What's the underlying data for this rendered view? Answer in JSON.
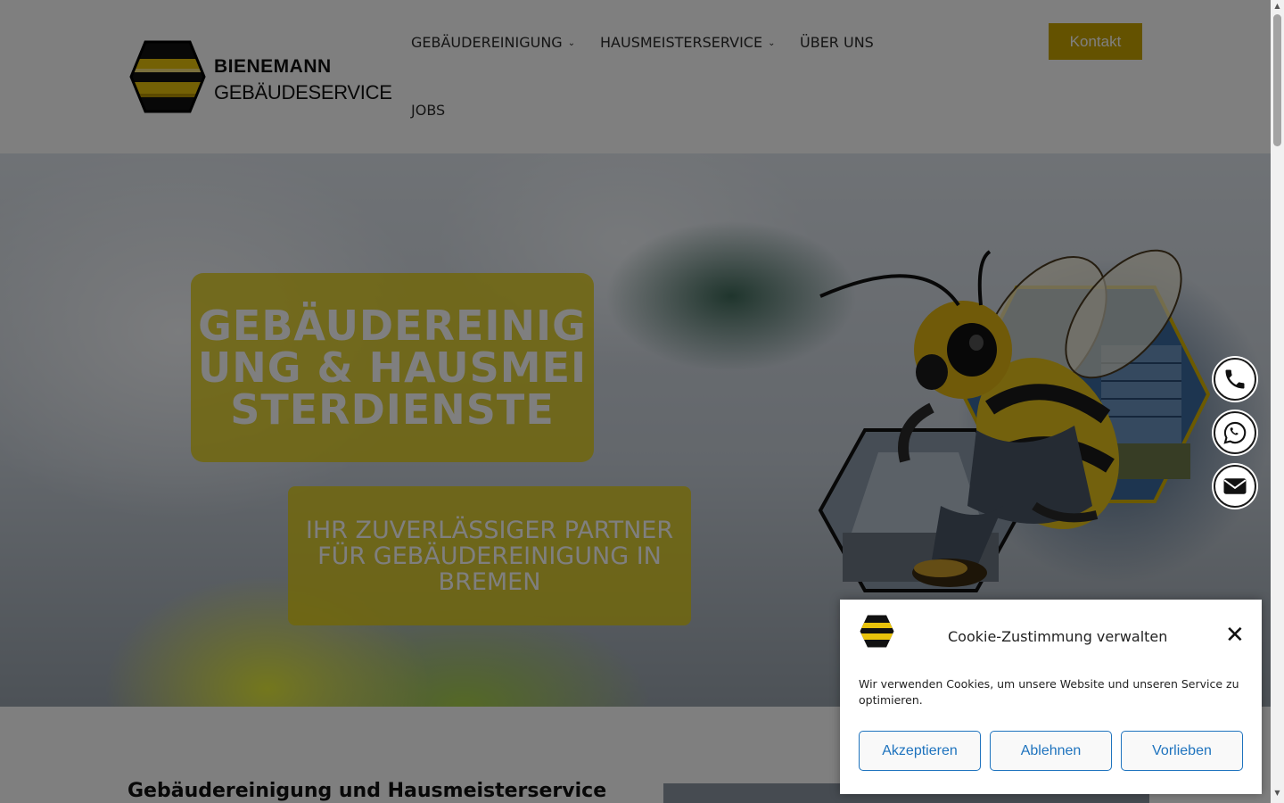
{
  "header": {
    "logo": {
      "line1": "BIENEMANN",
      "line2": "GEBÄUDESERVICE"
    },
    "nav": [
      {
        "label": "GEBÄUDEREINIGUNG",
        "has_dropdown": true
      },
      {
        "label": "HAUSMEISTERSERVICE",
        "has_dropdown": true
      },
      {
        "label": "ÜBER UNS",
        "has_dropdown": false
      },
      {
        "label": "JOBS",
        "has_dropdown": false
      }
    ],
    "cta_label": "Kontakt"
  },
  "hero": {
    "title": "GEBÄUDEREINIGUNG & HAUSMEISTERDIENSTE",
    "subtitle_line1": "IHR ZUVERLÄSSIGER PARTNER",
    "subtitle_line2": "FÜR GEBÄUDEREINIGUNG IN BREMEN"
  },
  "content": {
    "heading": "Gebäudereinigung und Hausmeisterservice"
  },
  "floating_contact": [
    {
      "icon": "phone-icon"
    },
    {
      "icon": "whatsapp-icon"
    },
    {
      "icon": "mail-icon"
    }
  ],
  "cookie_dialog": {
    "title": "Cookie-Zustimmung verwalten",
    "text": "Wir verwenden Cookies, um unsere Website und unseren Service zu optimieren.",
    "accept": "Akzeptieren",
    "decline": "Ablehnen",
    "preferences": "Vorlieben"
  },
  "colors": {
    "brand_yellow": "#c9a400",
    "hero_box": "#e3ce14",
    "link_blue": "#1e73be"
  }
}
